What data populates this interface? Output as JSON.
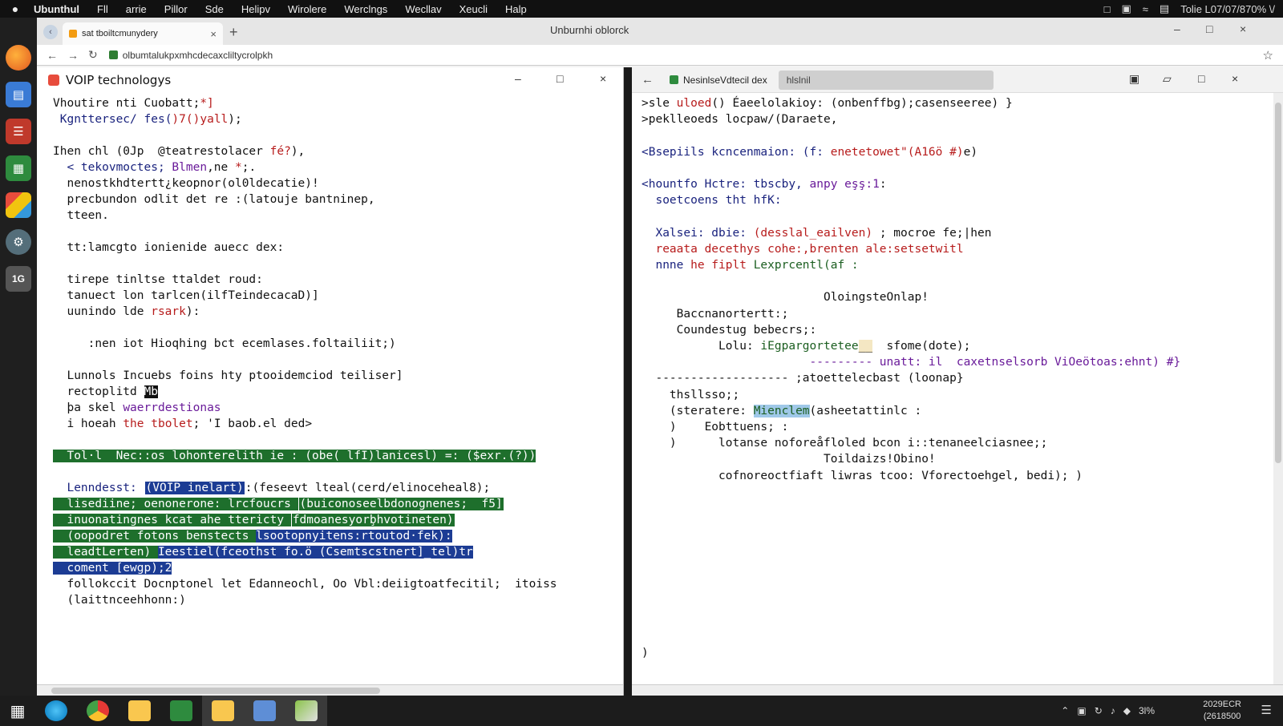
{
  "menubar": {
    "app": "Ubunthul",
    "items": [
      "Fll",
      "arrie",
      "Pillor",
      "Sde",
      "Helipv",
      "Wirolere",
      "Werclngs",
      "Wecllav",
      "Xeucli",
      "Halp"
    ],
    "tray_text": "Tolie L07/07/870% \\/"
  },
  "icons": {
    "dock": [
      "firefox-icon",
      "files-icon",
      "document-icon",
      "spreadsheet-icon",
      "apps-icon",
      "settings-gear-icon",
      "terminal-icon"
    ],
    "dock_terminal_label": "1G"
  },
  "browser": {
    "tab_title": "sat tboiltcmunydery",
    "window_title": "Unburnhi oblorck",
    "url": "olbumtalukpxmhcdecaxcliltycrolpkh"
  },
  "left_pane": {
    "title": "VOIP technologys",
    "lines": [
      [
        {
          "t": "Vhoutire nti Cuobatt;",
          "c": ""
        },
        {
          "t": "*]",
          "c": "k-red"
        }
      ],
      [
        {
          "t": " Kgnttersec/ ",
          "c": "k-blue"
        },
        {
          "t": "fes(",
          "c": "k-blue"
        },
        {
          "t": ")7(",
          "c": "k-red"
        },
        {
          "t": ")yall",
          "c": "k-red"
        },
        {
          "t": ");",
          "c": ""
        }
      ],
      [
        {
          "t": "",
          "c": ""
        }
      ],
      [
        {
          "t": "Ihen chl (0Jp  @teatrestolacer ",
          "c": ""
        },
        {
          "t": "fé?",
          "c": "k-red"
        },
        {
          "t": "),",
          "c": ""
        }
      ],
      [
        {
          "t": "  < tekovmoctes; ",
          "c": "k-blue"
        },
        {
          "t": "Blmen",
          "c": "k-purple"
        },
        {
          "t": ",ne ",
          "c": ""
        },
        {
          "t": "*",
          "c": "k-red"
        },
        {
          "t": ";.",
          "c": ""
        }
      ],
      [
        {
          "t": "  nenostkhdtertt¿keopnor(ol0ldecatie)!",
          "c": ""
        }
      ],
      [
        {
          "t": "  precbundon odlit det re :(latouje bantninep,",
          "c": ""
        }
      ],
      [
        {
          "t": "  tteen.",
          "c": ""
        }
      ],
      [
        {
          "t": "",
          "c": ""
        }
      ],
      [
        {
          "t": "  tt:lamcgto ionienide auecc dex:",
          "c": ""
        }
      ],
      [
        {
          "t": "",
          "c": ""
        }
      ],
      [
        {
          "t": "  tirepe tinltse ttaldet roud:",
          "c": ""
        }
      ],
      [
        {
          "t": "  tanuect lon tarlcen(ilfTeindecacaD)]",
          "c": ""
        }
      ],
      [
        {
          "t": "  uunindo lde ",
          "c": ""
        },
        {
          "t": "rsark",
          "c": "k-red"
        },
        {
          "t": "):",
          "c": ""
        }
      ],
      [
        {
          "t": "",
          "c": ""
        }
      ],
      [
        {
          "t": "     :nen iot Hioqhing bct ecemlases.foltailiit;)",
          "c": ""
        }
      ],
      [
        {
          "t": "",
          "c": ""
        }
      ],
      [
        {
          "t": "  Lunnols Incuebs foins hty ptooidemciod teiliser]",
          "c": ""
        }
      ],
      [
        {
          "t": "  rectoplitd ",
          "c": ""
        },
        {
          "t": "Mb",
          "c": "hl-dark"
        }
      ],
      [
        {
          "t": "  þa skel ",
          "c": ""
        },
        {
          "t": "waerrdestionas",
          "c": "k-purple"
        }
      ],
      [
        {
          "t": "  i hoeah ",
          "c": ""
        },
        {
          "t": "the",
          "c": "k-red"
        },
        {
          "t": " ",
          "c": ""
        },
        {
          "t": "tbolet",
          "c": "k-red"
        },
        {
          "t": "; ",
          "c": ""
        },
        {
          "t": "'I",
          "c": ""
        },
        {
          "t": " baob.el ded>",
          "c": ""
        }
      ],
      [
        {
          "t": "",
          "c": ""
        }
      ],
      [
        {
          "t": "  Tol·l  Nec::os lohonterelith ie : (obe( lfI)lanicesl) =: ($exr.(?))",
          "c": "hl-green"
        }
      ],
      [
        {
          "t": "",
          "c": ""
        }
      ],
      [
        {
          "t": "  Lenndesst: ",
          "c": "k-blue"
        },
        {
          "t": "(VOIP inelart)",
          "c": "hl-blue hl-box"
        },
        {
          "t": ":(feseevt lteal(cerd/elinoceheal8);",
          "c": ""
        }
      ],
      [
        {
          "t": "  lisediine; oenonerone: lrcfoucrs ",
          "c": "hl-green"
        },
        {
          "t": "(buiconoseelbdonognenes;  f5]",
          "c": "hl-green hl-box"
        }
      ],
      [
        {
          "t": "  inuonatingnes kcat ahe ttericty ",
          "c": "hl-green"
        },
        {
          "t": "fdmoanesyorb̧hvotineten)",
          "c": "hl-green hl-box"
        }
      ],
      [
        {
          "t": "  (oopodret fotons benstects ",
          "c": "hl-green"
        },
        {
          "t": "lsootopnyitens:rtoutod·fek):",
          "c": "hl-blue"
        }
      ],
      [
        {
          "t": "  leadtLerten) ",
          "c": "hl-green"
        },
        {
          "t": "Ieestiel(fceothst fo.ö (Csemtscstnert]_tel)tr",
          "c": "hl-blue"
        }
      ],
      [
        {
          "t": "  coment [ewgp);2",
          "c": "hl-blue"
        }
      ],
      [
        {
          "t": "  follokccit Docnptonel let Edanneochl, Oo Vbl:deiigtoatfecitil;  itoiss",
          "c": ""
        }
      ],
      [
        {
          "t": "  (laittnceehhonn:)",
          "c": ""
        }
      ]
    ]
  },
  "right_pane": {
    "tab_title": "NesinlseVdtecil dex",
    "search_value": "hlslnil",
    "lines": [
      [
        {
          "t": ">sle ",
          "c": ""
        },
        {
          "t": "uloed",
          "c": "k-red"
        },
        {
          "t": "() Éaeelolakioy: (onbenffbg);casenseeree) }",
          "c": ""
        }
      ],
      [
        {
          "t": ">peklleoeds locpaw/(Daraete,",
          "c": ""
        }
      ],
      [
        {
          "t": "",
          "c": ""
        }
      ],
      [
        {
          "t": "<Bsepiils ",
          "c": "k-blue"
        },
        {
          "t": "kcncenmaion: (f: ",
          "c": "k-blue"
        },
        {
          "t": "enetetowet\"(A16ö #)",
          "c": "k-red"
        },
        {
          "t": "e)",
          "c": ""
        }
      ],
      [
        {
          "t": "",
          "c": ""
        }
      ],
      [
        {
          "t": "<hountfo Hctre: tbscby, ",
          "c": "k-blue"
        },
        {
          "t": "anpy eşş:1",
          "c": "k-purple"
        },
        {
          "t": ":",
          "c": ""
        }
      ],
      [
        {
          "t": "  soetcoens tht hfK:",
          "c": "k-blue"
        }
      ],
      [
        {
          "t": "",
          "c": ""
        }
      ],
      [
        {
          "t": "  Xalsei: dbie: ",
          "c": "k-blue"
        },
        {
          "t": "(desslal_eailven)",
          "c": "k-red"
        },
        {
          "t": " ; mocroe fe;|hen",
          "c": ""
        }
      ],
      [
        {
          "t": "  reaata decethys cohe:,brenten ale:setsetwitl",
          "c": "k-red"
        }
      ],
      [
        {
          "t": "  nnne ",
          "c": "k-blue"
        },
        {
          "t": "he fiplt ",
          "c": "k-red"
        },
        {
          "t": "Lexprcentl(af :",
          "c": "k-green"
        }
      ],
      [
        {
          "t": "",
          "c": ""
        }
      ],
      [
        {
          "t": "                          OloingsteOnlap!",
          "c": ""
        }
      ],
      [
        {
          "t": "     Baccnanortertt:;",
          "c": ""
        }
      ],
      [
        {
          "t": "     Coundestug bebecrs;:",
          "c": ""
        }
      ],
      [
        {
          "t": "           Lolu: ",
          "c": ""
        },
        {
          "t": "iEgpargortetee",
          "c": "k-green"
        },
        {
          "t": "__",
          "c": "hl-cream"
        },
        {
          "t": "  sfome(dote);",
          "c": ""
        }
      ],
      [
        {
          "t": "                        --------- unatt: il  caxetnselsorb ViOeötoas:ehnt) #}",
          "c": "k-purple"
        }
      ],
      [
        {
          "t": "  ------------------- ;atoettelecbast (loonap}",
          "c": ""
        }
      ],
      [
        {
          "t": "    thsllsso;;",
          "c": ""
        }
      ],
      [
        {
          "t": "    (steratere: ",
          "c": ""
        },
        {
          "t": "Mienclem",
          "c": "k-green hl-sky"
        },
        {
          "t": "(asheetattinlc :",
          "c": ""
        }
      ],
      [
        {
          "t": "    )    Eobttuens; :",
          "c": ""
        }
      ],
      [
        {
          "t": "    )      lotanse noforeåfloled bcon i::tenaneelciasnee;;",
          "c": ""
        }
      ],
      [
        {
          "t": "                          Toildaizs!Obino!",
          "c": ""
        }
      ],
      [
        {
          "t": "           cofnoreoctfiaft liwras tcoo: Vforectoehgel, bedi); )",
          "c": ""
        }
      ]
    ],
    "closing": ")"
  },
  "taskbar": {
    "clock_time": "2029ECR",
    "clock_date": "(2618500",
    "tray_text": "3l%"
  }
}
